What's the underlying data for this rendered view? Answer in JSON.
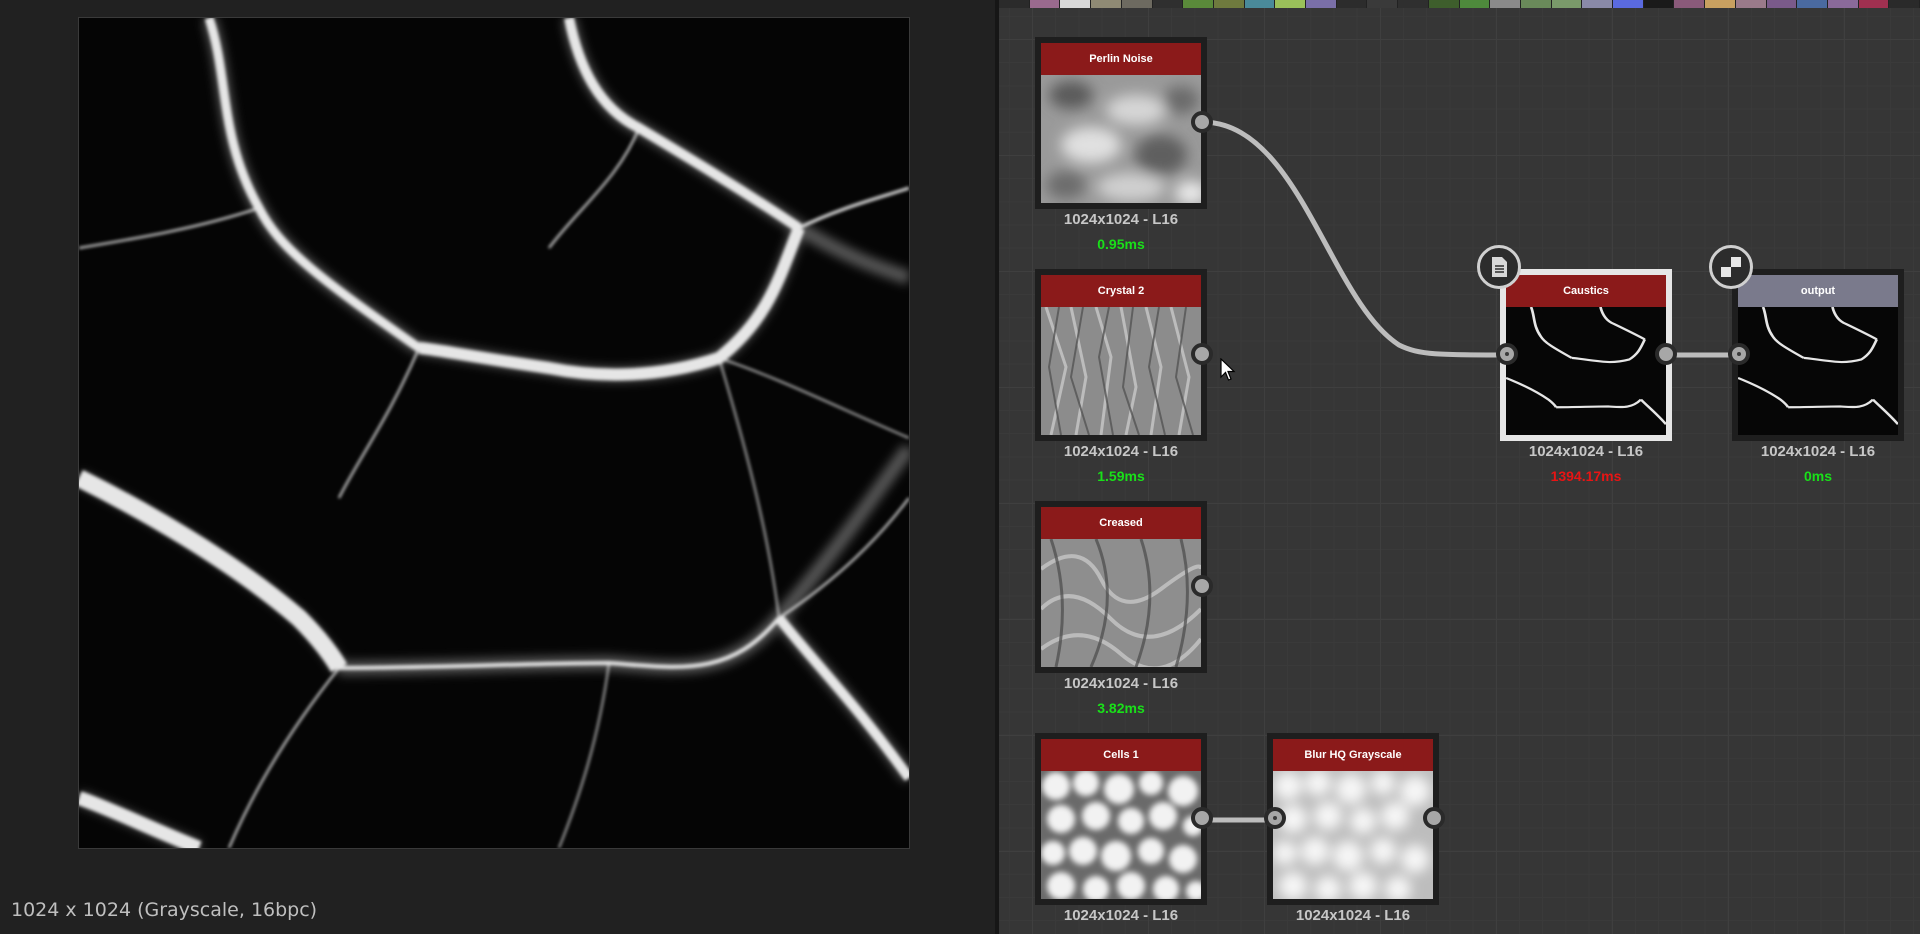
{
  "status_bar": {
    "text": "1024 x 1024 (Grayscale, 16bpc)"
  },
  "nodes": {
    "perlin": {
      "title": "Perlin Noise",
      "res": "1024x1024 - L16",
      "time": "0.95ms"
    },
    "crystal": {
      "title": "Crystal 2",
      "res": "1024x1024 - L16",
      "time": "1.59ms"
    },
    "creased": {
      "title": "Creased",
      "res": "1024x1024 - L16",
      "time": "3.82ms"
    },
    "cells": {
      "title": "Cells 1",
      "res": "1024x1024 - L16"
    },
    "blur": {
      "title": "Blur HQ Grayscale",
      "res": "1024x1024 - L16"
    },
    "caustics": {
      "title": "Caustics",
      "res": "1024x1024 - L16",
      "time": "1394.17ms"
    },
    "output": {
      "title": "output",
      "res": "1024x1024 - L16",
      "time": "0ms"
    }
  },
  "colors": {
    "time_ok": "#19e019",
    "time_slow": "#e81414",
    "node_header": "#8b1a1a",
    "output_header": "#7a7a8c"
  },
  "icons": {
    "caustics_badge": "document-icon",
    "output_badge": "checker-icon",
    "cursor": "mouse-pointer-icon"
  },
  "swatches": [
    "#2b2b2b",
    "#9a6a8e",
    "#d9d9d9",
    "#8f8a74",
    "#6d6a60",
    "#2f2f2f",
    "#5a8a3a",
    "#6f7a3e",
    "#4a8a9a",
    "#9ac05a",
    "#7a6fa8",
    "#2c2c2c",
    "#3a3a3a",
    "#2f2f2f",
    "#3e5e2c",
    "#4e8a3c",
    "#8a8a8a",
    "#6a8a5a",
    "#7a9a6a",
    "#8a8aa8",
    "#5a6ae0",
    "#1a1a1a",
    "#8a5a7a",
    "#c8a060",
    "#9a7a8a",
    "#7a5a8a",
    "#4a6aa0",
    "#8a6a9a",
    "#a03050",
    "#2a2a2a"
  ]
}
